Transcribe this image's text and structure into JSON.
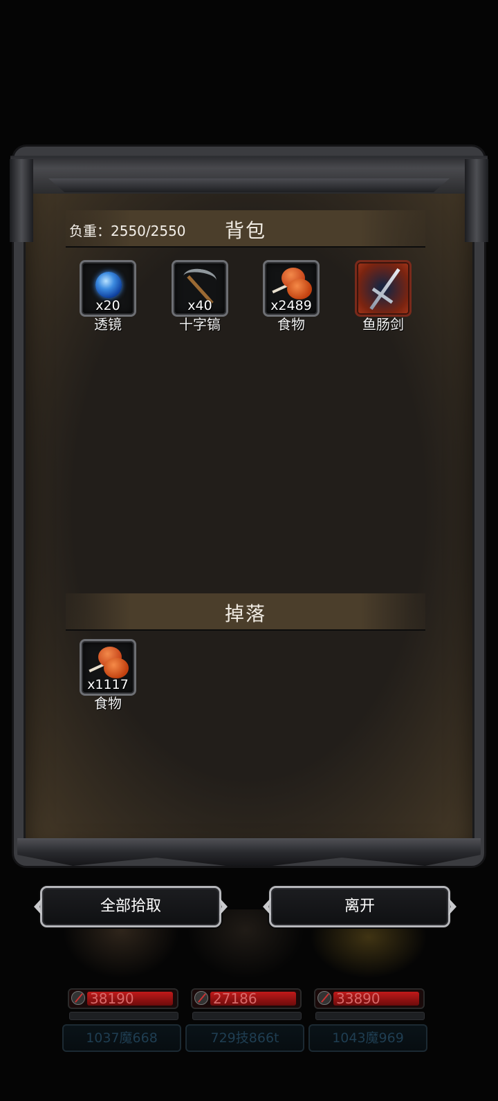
{
  "inventory": {
    "title": "背包",
    "weight_label": "负重：2550/2550",
    "items": [
      {
        "name": "透镜",
        "count": "x20",
        "icon": "lens-icon"
      },
      {
        "name": "十字镐",
        "count": "x40",
        "icon": "pickaxe-icon"
      },
      {
        "name": "食物",
        "count": "x2489",
        "icon": "meat-icon"
      },
      {
        "name": "鱼肠剑",
        "count": "",
        "icon": "sword-icon"
      }
    ]
  },
  "drops": {
    "title": "掉落",
    "items": [
      {
        "name": "食物",
        "count": "x1117",
        "icon": "meat-icon"
      }
    ]
  },
  "buttons": {
    "pickup_all": "全部拾取",
    "leave": "离开"
  },
  "party": [
    {
      "hp": "38190",
      "stats": "1037魔668"
    },
    {
      "hp": "27186",
      "stats": "729技866t"
    },
    {
      "hp": "33890",
      "stats": "1043魔969"
    }
  ],
  "colors": {
    "panel_bg": "#221e1a",
    "header_bg": "#4b3e2b",
    "frame": "#3b3c40",
    "hp_red": "#c11a1a",
    "rare_slot": "#a5361a"
  }
}
